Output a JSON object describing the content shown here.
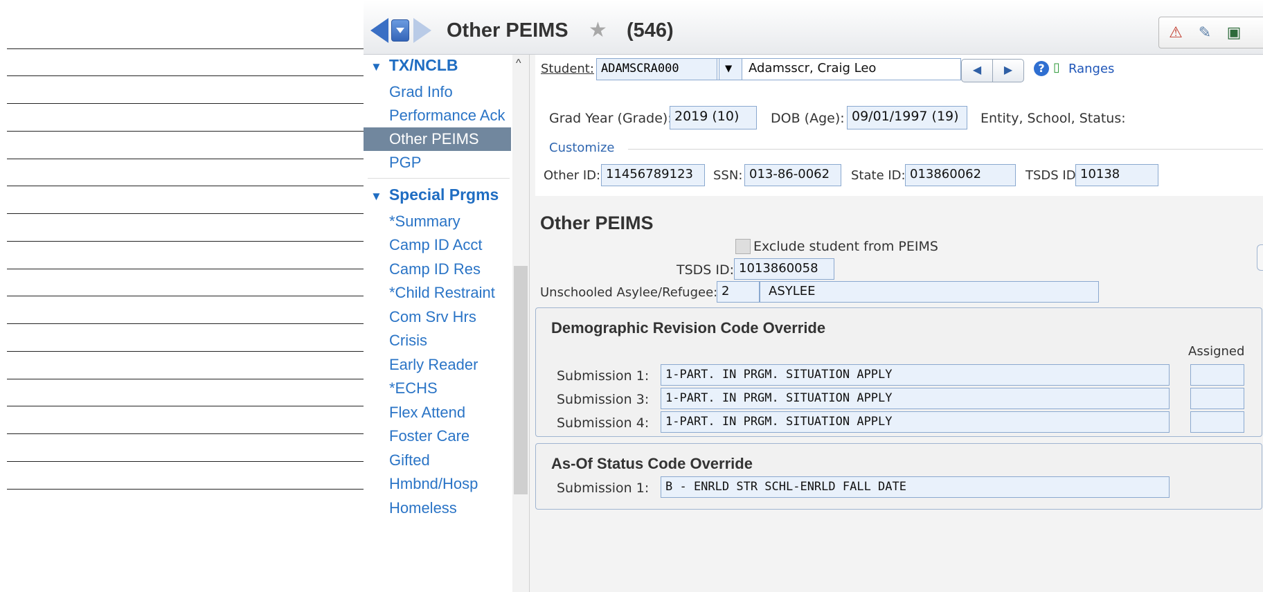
{
  "header": {
    "title": "Other PEIMS",
    "count": "(546)",
    "icons": [
      "back-arrow-icon",
      "history-dropdown-icon",
      "forward-arrow-icon",
      "favorite-star-icon",
      "alert-icon",
      "notes-icon",
      "monitor-icon"
    ]
  },
  "sidebar": {
    "groups": [
      {
        "label": "TX/NCLB",
        "items": [
          "Grad Info",
          "Performance Ack",
          "Other PEIMS",
          "PGP"
        ]
      },
      {
        "label": "Special Prgms",
        "items": [
          "*Summary",
          "Camp ID Acct",
          "Camp ID Res",
          "*Child Restraint",
          "Com Srv Hrs",
          "Crisis",
          "Early Reader",
          "*ECHS",
          "Flex Attend",
          "Foster Care",
          "Gifted",
          "Hmbnd/Hosp",
          "Homeless"
        ]
      }
    ],
    "active_item": "Other PEIMS"
  },
  "student": {
    "link_label": "Student:",
    "id_value": "ADAMSCRA000",
    "name_value": "Adamsscr, Craig Leo",
    "ranges_label": "Ranges"
  },
  "info": {
    "grad_year_label": "Grad Year (Grade):",
    "grad_year_value": "2019 (10)",
    "dob_label": "DOB (Age):",
    "dob_value": "09/01/1997 (19)",
    "entity_label": "Entity, School, Status:",
    "customize_label": "Customize",
    "other_id_label": "Other ID:",
    "other_id_value": "11456789123",
    "ssn_label": "SSN:",
    "ssn_value": "013-86-0062",
    "state_id_label": "State ID:",
    "state_id_value": "013860062",
    "tsds_id_label": "TSDS ID:",
    "tsds_id_value": "10138"
  },
  "other_peims": {
    "section_title": "Other PEIMS",
    "exclude_label": "Exclude student from PEIMS",
    "tsds_label": "TSDS ID:",
    "tsds_value": "1013860058",
    "asylee_label": "Unschooled Asylee/Refugee:",
    "asylee_code": "2",
    "asylee_desc": "ASYLEE"
  },
  "demographic": {
    "title": "Demographic Revision Code Override",
    "assigned_label": "Assigned",
    "rows": [
      {
        "label": "Submission 1:",
        "value": "1-PART. IN PRGM. SITUATION APPLY"
      },
      {
        "label": "Submission 3:",
        "value": "1-PART. IN PRGM. SITUATION APPLY"
      },
      {
        "label": "Submission 4:",
        "value": "1-PART. IN PRGM. SITUATION APPLY"
      }
    ]
  },
  "asof": {
    "title": "As-Of Status Code Override",
    "rows": [
      {
        "label": "Submission 1:",
        "value": "B - ENRLD STR SCHL-ENRLD FALL DATE"
      }
    ]
  },
  "colors": {
    "accent_blue": "#1f6dc2",
    "active_bg": "#71879e",
    "field_bg": "#e9f1fb"
  }
}
